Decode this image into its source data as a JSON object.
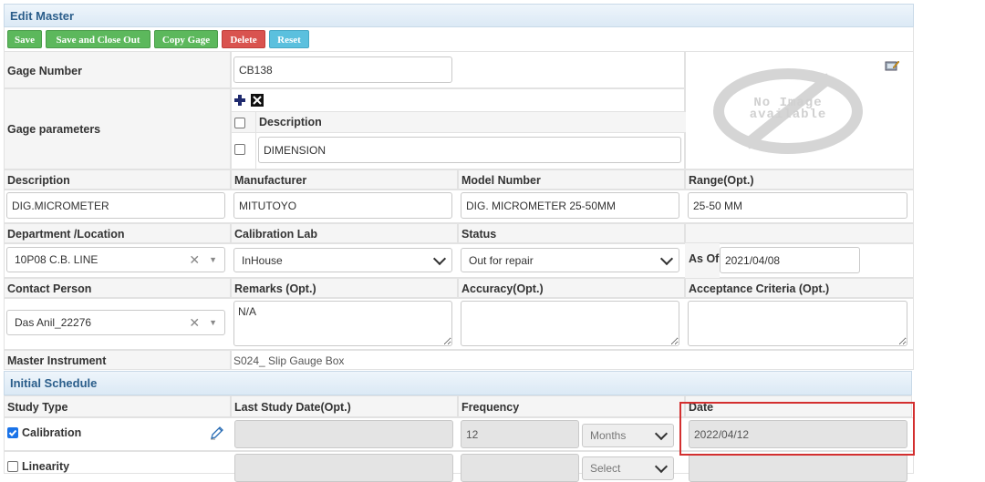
{
  "panel": {
    "title": "Edit Master"
  },
  "toolbar": {
    "save": "Save",
    "save_close": "Save and Close Out",
    "copy": "Copy Gage",
    "delete": "Delete",
    "reset": "Reset"
  },
  "gage_number": {
    "label": "Gage Number",
    "value": "CB138"
  },
  "gage_params": {
    "label": "Gage parameters",
    "col_header": "Description",
    "rows": [
      {
        "value": "DIMENSION"
      }
    ]
  },
  "image": {
    "text_line1": "No Image",
    "text_line2": "available"
  },
  "description": {
    "label": "Description",
    "value": "DIG.MICROMETER"
  },
  "manufacturer": {
    "label": "Manufacturer",
    "value": "MITUTOYO"
  },
  "model_number": {
    "label": "Model Number",
    "value": "DIG. MICROMETER 25-50MM"
  },
  "range": {
    "label": "Range(Opt.)",
    "value": "25-50 MM"
  },
  "department": {
    "label": "Department /Location",
    "value": "10P08 C.B. LINE"
  },
  "calibration_lab": {
    "label": "Calibration Lab",
    "value": "InHouse"
  },
  "status": {
    "label": "Status",
    "value": "Out for repair"
  },
  "as_of": {
    "label": "As Of",
    "value": "2021/04/08"
  },
  "contact_person": {
    "label": "Contact Person",
    "value": "Das Anil_22276"
  },
  "remarks": {
    "label": "Remarks (Opt.)",
    "value": "N/A"
  },
  "accuracy": {
    "label": "Accuracy(Opt.)",
    "value": ""
  },
  "acceptance": {
    "label": "Acceptance Criteria (Opt.)",
    "value": ""
  },
  "master_instrument": {
    "label": "Master Instrument",
    "value": "S024_ Slip Gauge Box"
  },
  "schedule": {
    "title": "Initial Schedule",
    "headers": {
      "study_type": "Study Type",
      "last_date": "Last Study Date(Opt.)",
      "frequency": "Frequency",
      "date": "Date"
    },
    "rows": [
      {
        "type": "Calibration",
        "checked": true,
        "last_date": "",
        "frequency": "12",
        "unit": "Months",
        "date": "2022/04/12"
      },
      {
        "type": "Linearity",
        "checked": false,
        "last_date": "",
        "frequency": "",
        "unit": "Select",
        "date": ""
      }
    ]
  },
  "colors": {
    "highlight": "#d32f2f"
  }
}
